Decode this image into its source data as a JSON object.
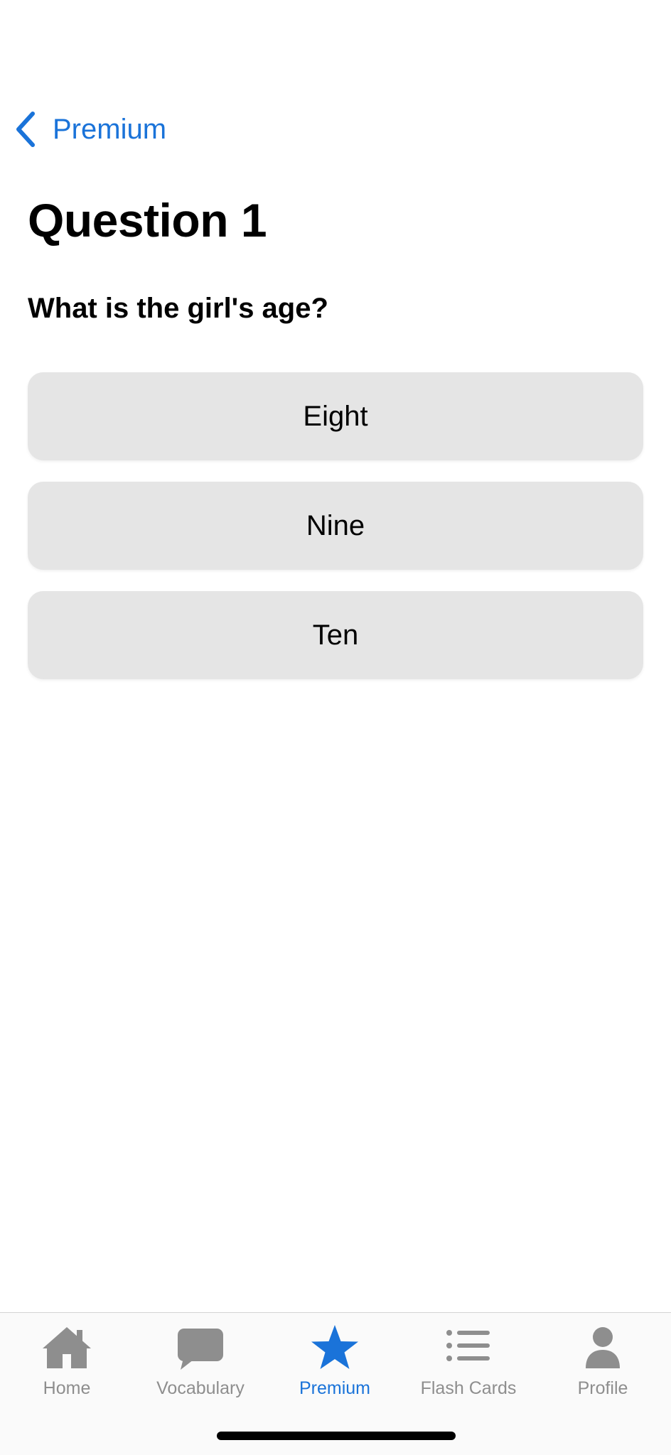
{
  "nav": {
    "back_label": "Premium"
  },
  "page": {
    "title": "Question 1",
    "question": "What is the girl's age?"
  },
  "answers": [
    {
      "label": "Eight"
    },
    {
      "label": "Nine"
    },
    {
      "label": "Ten"
    }
  ],
  "tabbar": {
    "active_tab": "Premium",
    "items": [
      {
        "label": "Home",
        "icon": "house-icon"
      },
      {
        "label": "Vocabulary",
        "icon": "speech-bubble-icon"
      },
      {
        "label": "Premium",
        "icon": "star-icon"
      },
      {
        "label": "Flash Cards",
        "icon": "list-icon"
      },
      {
        "label": "Profile",
        "icon": "person-icon"
      }
    ]
  },
  "colors": {
    "accent": "#1a73d9",
    "inactive_tab": "#8e8e8e",
    "answer_background": "#e5e5e5"
  }
}
